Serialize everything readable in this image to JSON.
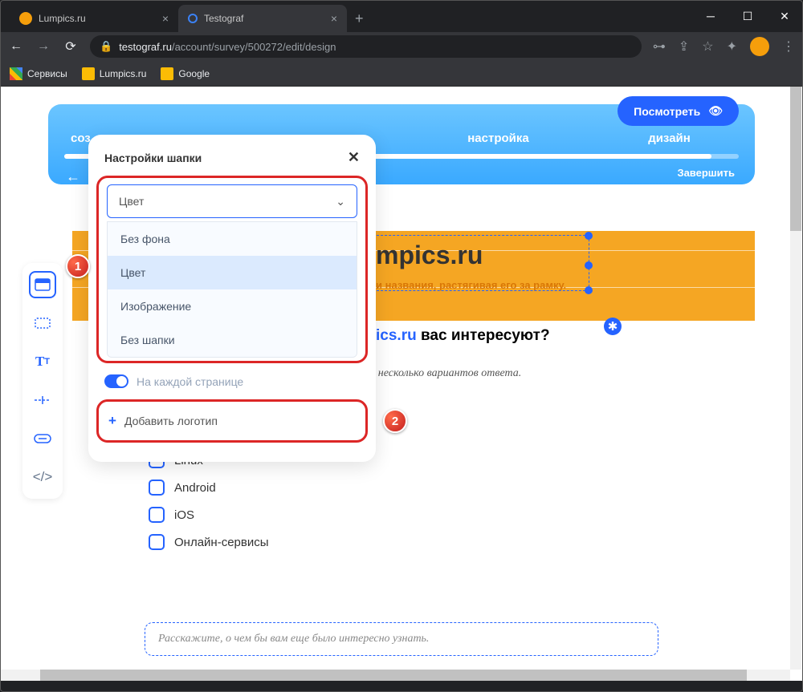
{
  "browser": {
    "tabs": [
      {
        "title": "Lumpics.ru",
        "favicon": "orange",
        "active": false
      },
      {
        "title": "Testograf",
        "favicon": "blue",
        "active": true
      }
    ],
    "url_domain": "testograf.ru",
    "url_path": "/account/survey/500272/edit/design",
    "bookmarks": {
      "services": "Сервисы",
      "lumpics": "Lumpics.ru",
      "google": "Google"
    }
  },
  "app": {
    "preview_btn": "Посмотреть",
    "nav": {
      "step1_partial": "соз",
      "step3": "настройка",
      "step4": "дизайн"
    },
    "finish": "Завершить"
  },
  "panel": {
    "title": "Настройки шапки",
    "select_value": "Цвет",
    "options": {
      "no_bg": "Без фона",
      "color": "Цвет",
      "image": "Изображение",
      "no_header": "Без шапки"
    },
    "every_page": "На каждой странице",
    "add_logo": "Добавить логотип"
  },
  "survey": {
    "brand_partial": "mpics.ru",
    "resize_hint": "и названия, растягивая его за рамку.",
    "question_partial_blue": "ics.ru",
    "question_partial_black": " вас интересуют?",
    "subhint": "Выберите один или несколько вариантов ответа.",
    "options": {
      "o1": "macOS",
      "o2": "Linux",
      "o3": "Android",
      "o4": "iOS",
      "o5": "Онлайн-сервисы"
    },
    "free_input": "Расскажите, о чем бы вам еще было интересно узнать."
  },
  "annotations": {
    "a1": "1",
    "a2": "2"
  }
}
